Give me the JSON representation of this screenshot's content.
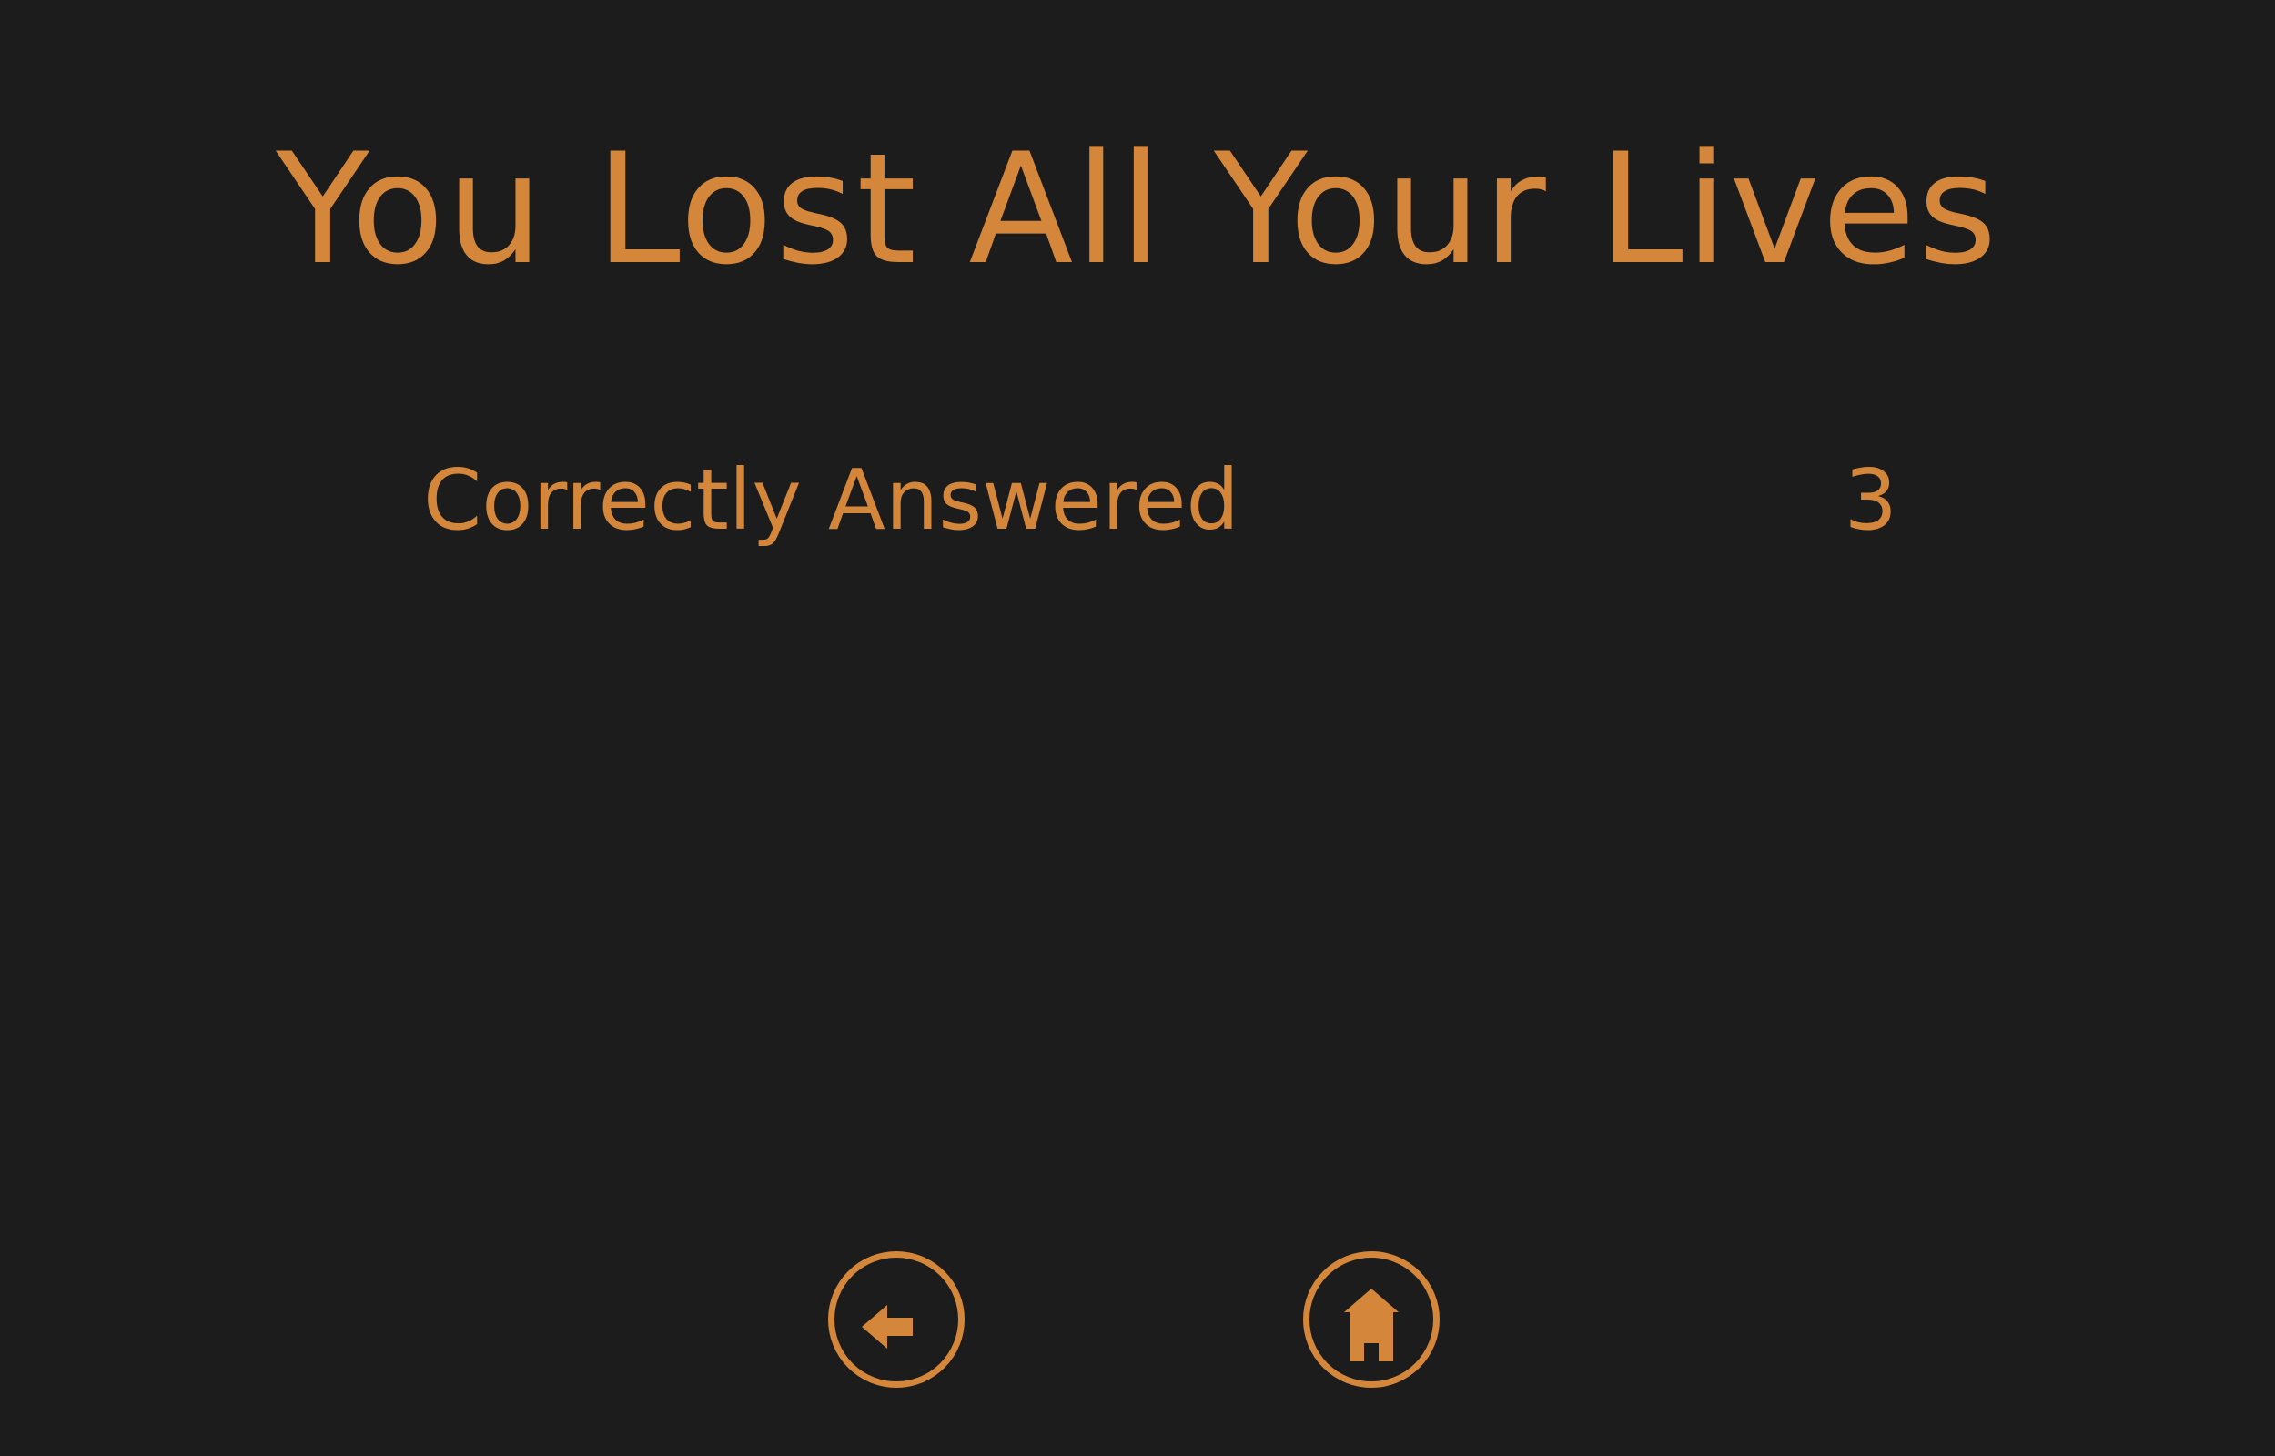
{
  "screen": {
    "title": "You Lost All Your Lives"
  },
  "stats": {
    "correct_label": "Correctly Answered",
    "correct_value": "3"
  },
  "buttons": {
    "back_icon": "back-arrow-icon",
    "home_icon": "home-icon"
  },
  "colors": {
    "background": "#1c1c1c",
    "accent": "#d4873a"
  }
}
